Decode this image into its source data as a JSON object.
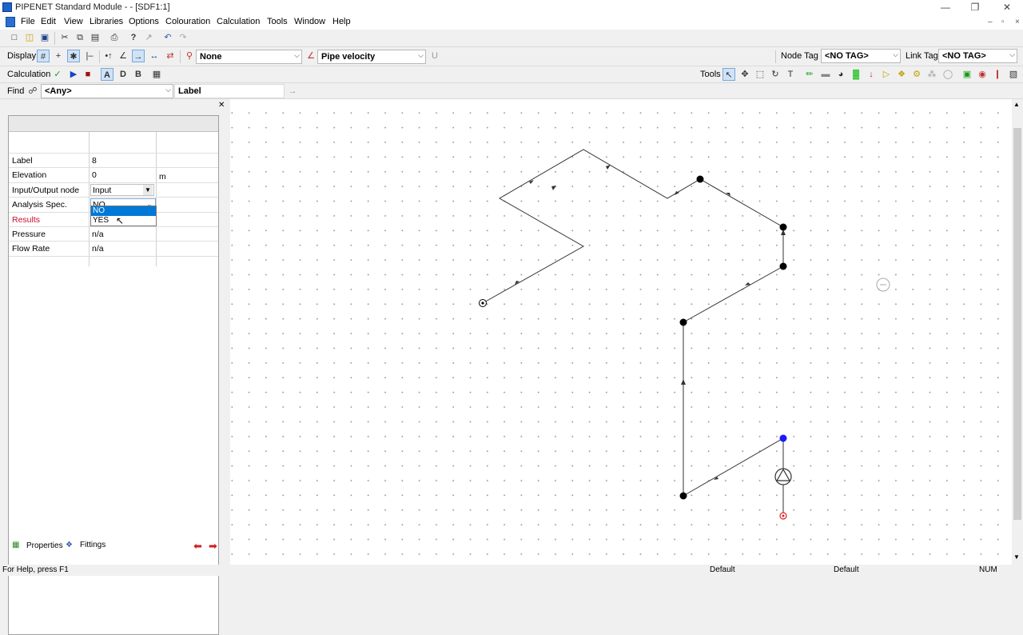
{
  "window": {
    "title": "PIPENET Standard Module - - [SDF1:1]",
    "minimize": "—",
    "restore": "❐",
    "close": "✕"
  },
  "menu": {
    "items": [
      "File",
      "Edit",
      "View",
      "Libraries",
      "Options",
      "Colouration",
      "Calculation",
      "Tools",
      "Window",
      "Help"
    ],
    "mdi_min": "–",
    "mdi_restore": "▫",
    "mdi_close": "×"
  },
  "toolbar_display": {
    "label": "Display",
    "node_colour_combo": "None",
    "link_colour_combo": "Pipe velocity",
    "node_tag_label": "Node Tag",
    "node_tag_value": "<NO TAG>",
    "link_tag_label": "Link Tag",
    "link_tag_value": "<NO TAG>"
  },
  "toolbar_calc": {
    "label": "Calculation",
    "btn_a": "A",
    "btn_d": "D",
    "btn_b": "B",
    "tools_label": "Tools"
  },
  "toolbar_find": {
    "label": "Find",
    "filter_value": "<Any>",
    "field_value": "Label"
  },
  "properties": {
    "rows": [
      {
        "name": "Label",
        "value": "8",
        "unit": ""
      },
      {
        "name": "Elevation",
        "value": "0",
        "unit": "m"
      },
      {
        "name": "Input/Output node",
        "value": "Input",
        "unit": ""
      },
      {
        "name": "Analysis Spec.",
        "value": "NO",
        "unit": ""
      },
      {
        "name": "Results",
        "value": "",
        "unit": ""
      },
      {
        "name": "Pressure",
        "value": "n/a",
        "unit": ""
      },
      {
        "name": "Flow Rate",
        "value": "n/a",
        "unit": ""
      }
    ],
    "dropdown_options": [
      "NO",
      "YES"
    ],
    "results_color": "#c8102e",
    "tabs": [
      "Properties",
      "Fittings"
    ]
  },
  "network": {
    "node_color": "#000000",
    "selected_node_color": "#1a1aff",
    "input_node_color": "#e02020"
  },
  "status": {
    "help": "For Help, press F1",
    "panel1": "Default",
    "panel2": "Default",
    "num": "NUM"
  }
}
